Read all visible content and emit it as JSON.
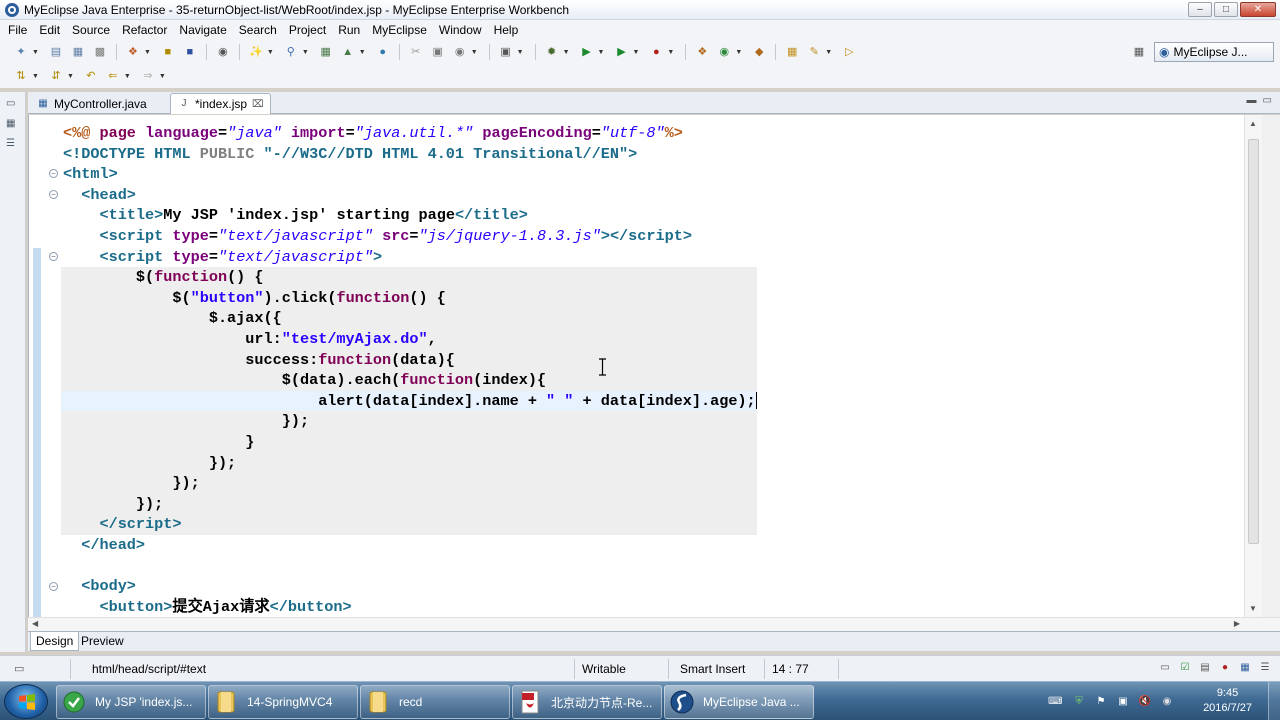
{
  "window": {
    "title": "MyEclipse Java Enterprise - 35-returnObject-list/WebRoot/index.jsp - MyEclipse Enterprise Workbench"
  },
  "menu": [
    "File",
    "Edit",
    "Source",
    "Refactor",
    "Navigate",
    "Search",
    "Project",
    "Run",
    "MyEclipse",
    "Window",
    "Help"
  ],
  "perspective": {
    "label": "MyEclipse J..."
  },
  "tabs": [
    {
      "label": "MyController.java",
      "active": false,
      "icon": "java-file-icon"
    },
    {
      "label": "*index.jsp",
      "active": true,
      "icon": "jsp-file-icon"
    }
  ],
  "editor": {
    "current_line_index": 13
  },
  "bottom_tabs": [
    {
      "label": "Design",
      "active": true
    },
    {
      "label": "Preview",
      "active": false
    }
  ],
  "status": {
    "path": "html/head/script/#text",
    "writable": "Writable",
    "insert_mode": "Smart Insert",
    "position": "14 : 77"
  },
  "taskbar": {
    "items": [
      {
        "label": "My JSP 'index.js...",
        "icon": "browser-icon",
        "active": false
      },
      {
        "label": "14-SpringMVC4",
        "icon": "folder-icon",
        "active": false
      },
      {
        "label": "recd",
        "icon": "folder-icon",
        "active": false
      },
      {
        "label": "北京动力节点-Re...",
        "icon": "pdf-icon",
        "active": false
      },
      {
        "label": "MyEclipse Java ...",
        "icon": "myeclipse-icon",
        "active": true
      }
    ],
    "clock_time": "9:45",
    "clock_date": "2016/7/27"
  },
  "colors": {
    "tag": "#1b6b8a",
    "attribute": "#7a007a",
    "string": "#2a00ff",
    "jsp_directive": "#b65a1a",
    "current_line": "#e8f2fe",
    "script_region": "#eeeeee"
  }
}
